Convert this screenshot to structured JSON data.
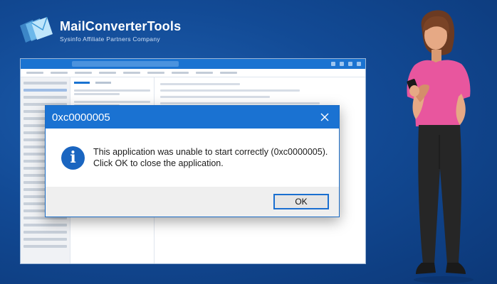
{
  "brand": {
    "name": "MailConverterTools",
    "tagline": "Sysinfo Affiliate Partners Company"
  },
  "dialog": {
    "title": "0xc0000005",
    "message_line1": "This application was unable to start correctly (0xc0000005).",
    "message_line2": "Click OK to close the application.",
    "ok_label": "OK"
  },
  "icons": {
    "logo": "envelope-stack-icon",
    "info": "info-icon",
    "close": "close-icon"
  },
  "colors": {
    "background": "#124a95",
    "dialog_titlebar": "#1a72d2",
    "info_icon": "#1a65c0",
    "ok_border": "#1a6fd0",
    "shirt": "#e8569e",
    "pants": "#262626"
  }
}
